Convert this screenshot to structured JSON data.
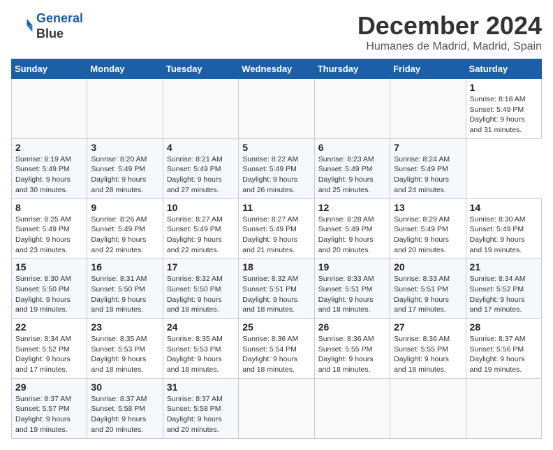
{
  "header": {
    "logo_line1": "General",
    "logo_line2": "Blue",
    "main_title": "December 2024",
    "subtitle": "Humanes de Madrid, Madrid, Spain"
  },
  "calendar": {
    "days_of_week": [
      "Sunday",
      "Monday",
      "Tuesday",
      "Wednesday",
      "Thursday",
      "Friday",
      "Saturday"
    ],
    "weeks": [
      [
        null,
        null,
        null,
        null,
        null,
        null,
        {
          "day": "1",
          "sunrise": "Sunrise: 8:18 AM",
          "sunset": "Sunset: 5:49 PM",
          "daylight": "Daylight: 9 hours and 31 minutes."
        }
      ],
      [
        {
          "day": "2",
          "sunrise": "Sunrise: 8:19 AM",
          "sunset": "Sunset: 5:49 PM",
          "daylight": "Daylight: 9 hours and 30 minutes."
        },
        {
          "day": "3",
          "sunrise": "Sunrise: 8:20 AM",
          "sunset": "Sunset: 5:49 PM",
          "daylight": "Daylight: 9 hours and 28 minutes."
        },
        {
          "day": "4",
          "sunrise": "Sunrise: 8:21 AM",
          "sunset": "Sunset: 5:49 PM",
          "daylight": "Daylight: 9 hours and 27 minutes."
        },
        {
          "day": "5",
          "sunrise": "Sunrise: 8:22 AM",
          "sunset": "Sunset: 5:49 PM",
          "daylight": "Daylight: 9 hours and 26 minutes."
        },
        {
          "day": "6",
          "sunrise": "Sunrise: 8:23 AM",
          "sunset": "Sunset: 5:49 PM",
          "daylight": "Daylight: 9 hours and 25 minutes."
        },
        {
          "day": "7",
          "sunrise": "Sunrise: 8:24 AM",
          "sunset": "Sunset: 5:49 PM",
          "daylight": "Daylight: 9 hours and 24 minutes."
        }
      ],
      [
        {
          "day": "8",
          "sunrise": "Sunrise: 8:25 AM",
          "sunset": "Sunset: 5:49 PM",
          "daylight": "Daylight: 9 hours and 23 minutes."
        },
        {
          "day": "9",
          "sunrise": "Sunrise: 8:26 AM",
          "sunset": "Sunset: 5:49 PM",
          "daylight": "Daylight: 9 hours and 22 minutes."
        },
        {
          "day": "10",
          "sunrise": "Sunrise: 8:27 AM",
          "sunset": "Sunset: 5:49 PM",
          "daylight": "Daylight: 9 hours and 22 minutes."
        },
        {
          "day": "11",
          "sunrise": "Sunrise: 8:27 AM",
          "sunset": "Sunset: 5:49 PM",
          "daylight": "Daylight: 9 hours and 21 minutes."
        },
        {
          "day": "12",
          "sunrise": "Sunrise: 8:28 AM",
          "sunset": "Sunset: 5:49 PM",
          "daylight": "Daylight: 9 hours and 20 minutes."
        },
        {
          "day": "13",
          "sunrise": "Sunrise: 8:29 AM",
          "sunset": "Sunset: 5:49 PM",
          "daylight": "Daylight: 9 hours and 20 minutes."
        },
        {
          "day": "14",
          "sunrise": "Sunrise: 8:30 AM",
          "sunset": "Sunset: 5:49 PM",
          "daylight": "Daylight: 9 hours and 19 minutes."
        }
      ],
      [
        {
          "day": "15",
          "sunrise": "Sunrise: 8:30 AM",
          "sunset": "Sunset: 5:50 PM",
          "daylight": "Daylight: 9 hours and 19 minutes."
        },
        {
          "day": "16",
          "sunrise": "Sunrise: 8:31 AM",
          "sunset": "Sunset: 5:50 PM",
          "daylight": "Daylight: 9 hours and 18 minutes."
        },
        {
          "day": "17",
          "sunrise": "Sunrise: 8:32 AM",
          "sunset": "Sunset: 5:50 PM",
          "daylight": "Daylight: 9 hours and 18 minutes."
        },
        {
          "day": "18",
          "sunrise": "Sunrise: 8:32 AM",
          "sunset": "Sunset: 5:51 PM",
          "daylight": "Daylight: 9 hours and 18 minutes."
        },
        {
          "day": "19",
          "sunrise": "Sunrise: 8:33 AM",
          "sunset": "Sunset: 5:51 PM",
          "daylight": "Daylight: 9 hours and 18 minutes."
        },
        {
          "day": "20",
          "sunrise": "Sunrise: 8:33 AM",
          "sunset": "Sunset: 5:51 PM",
          "daylight": "Daylight: 9 hours and 17 minutes."
        },
        {
          "day": "21",
          "sunrise": "Sunrise: 8:34 AM",
          "sunset": "Sunset: 5:52 PM",
          "daylight": "Daylight: 9 hours and 17 minutes."
        }
      ],
      [
        {
          "day": "22",
          "sunrise": "Sunrise: 8:34 AM",
          "sunset": "Sunset: 5:52 PM",
          "daylight": "Daylight: 9 hours and 17 minutes."
        },
        {
          "day": "23",
          "sunrise": "Sunrise: 8:35 AM",
          "sunset": "Sunset: 5:53 PM",
          "daylight": "Daylight: 9 hours and 18 minutes."
        },
        {
          "day": "24",
          "sunrise": "Sunrise: 8:35 AM",
          "sunset": "Sunset: 5:53 PM",
          "daylight": "Daylight: 9 hours and 18 minutes."
        },
        {
          "day": "25",
          "sunrise": "Sunrise: 8:36 AM",
          "sunset": "Sunset: 5:54 PM",
          "daylight": "Daylight: 9 hours and 18 minutes."
        },
        {
          "day": "26",
          "sunrise": "Sunrise: 8:36 AM",
          "sunset": "Sunset: 5:55 PM",
          "daylight": "Daylight: 9 hours and 18 minutes."
        },
        {
          "day": "27",
          "sunrise": "Sunrise: 8:36 AM",
          "sunset": "Sunset: 5:55 PM",
          "daylight": "Daylight: 9 hours and 18 minutes."
        },
        {
          "day": "28",
          "sunrise": "Sunrise: 8:37 AM",
          "sunset": "Sunset: 5:56 PM",
          "daylight": "Daylight: 9 hours and 19 minutes."
        }
      ],
      [
        {
          "day": "29",
          "sunrise": "Sunrise: 8:37 AM",
          "sunset": "Sunset: 5:57 PM",
          "daylight": "Daylight: 9 hours and 19 minutes."
        },
        {
          "day": "30",
          "sunrise": "Sunrise: 8:37 AM",
          "sunset": "Sunset: 5:58 PM",
          "daylight": "Daylight: 9 hours and 20 minutes."
        },
        {
          "day": "31",
          "sunrise": "Sunrise: 8:37 AM",
          "sunset": "Sunset: 5:58 PM",
          "daylight": "Daylight: 9 hours and 20 minutes."
        },
        null,
        null,
        null,
        null
      ]
    ]
  }
}
